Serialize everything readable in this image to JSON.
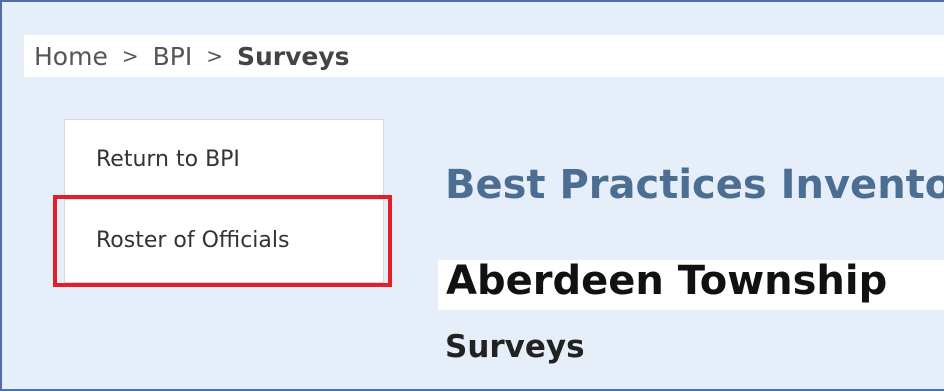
{
  "breadcrumb": {
    "items": [
      "Home",
      "BPI",
      "Surveys"
    ],
    "separator": ">"
  },
  "sidebar": {
    "items": [
      {
        "label": "Return to BPI"
      },
      {
        "label": "Roster of Officials"
      }
    ],
    "highlight_color": "#e41e26"
  },
  "main": {
    "heading": "Best Practices Inventory",
    "entity": "Aberdeen Township",
    "section": "Surveys"
  },
  "colors": {
    "background": "#e6eef9",
    "heading": "#4c6e93",
    "frame_border": "#4f6fa8"
  }
}
